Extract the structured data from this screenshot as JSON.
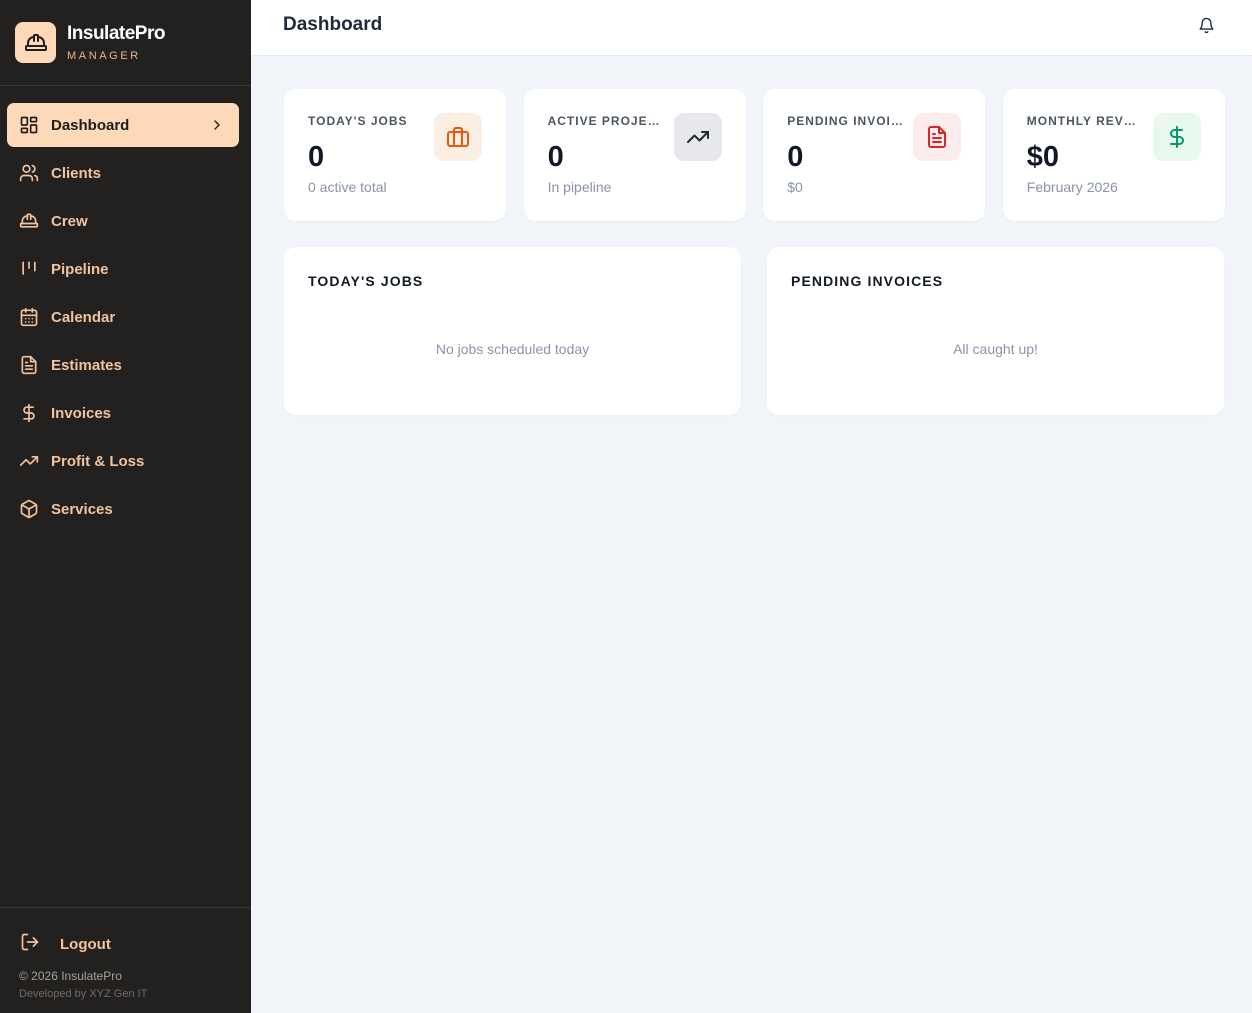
{
  "brand": {
    "name": "InsulatePro",
    "subtitle": "MANAGER"
  },
  "nav": {
    "items": [
      {
        "label": "Dashboard",
        "icon": "dashboard-icon",
        "active": true
      },
      {
        "label": "Clients",
        "icon": "users-icon"
      },
      {
        "label": "Crew",
        "icon": "hard-hat-icon"
      },
      {
        "label": "Pipeline",
        "icon": "kanban-icon"
      },
      {
        "label": "Calendar",
        "icon": "calendar-icon"
      },
      {
        "label": "Estimates",
        "icon": "file-text-icon"
      },
      {
        "label": "Invoices",
        "icon": "dollar-icon"
      },
      {
        "label": "Profit & Loss",
        "icon": "trending-up-icon"
      },
      {
        "label": "Services",
        "icon": "package-icon"
      }
    ]
  },
  "footer": {
    "logout_label": "Logout",
    "copyright": "© 2026 InsulatePro",
    "developed_by": "Developed by XYZ Gen IT"
  },
  "header": {
    "title": "Dashboard"
  },
  "stats": [
    {
      "label": "TODAY'S JOBS",
      "value": "0",
      "sub": "0 active total",
      "icon": "briefcase-icon",
      "icon_bg": "#fdeee4",
      "icon_color": "#ea580c"
    },
    {
      "label": "ACTIVE PROJECTS",
      "value": "0",
      "sub": "In pipeline",
      "icon": "trending-up-icon",
      "icon_bg": "#e6e8eb",
      "icon_color": "#1f2937"
    },
    {
      "label": "PENDING INVOICES",
      "value": "0",
      "sub": "$0",
      "icon": "file-text-icon",
      "icon_bg": "#fdecec",
      "icon_color": "#dc2626"
    },
    {
      "label": "MONTHLY REVENUE",
      "value": "$0",
      "sub": "February 2026",
      "icon": "dollar-icon",
      "icon_bg": "#e8f8ef",
      "icon_color": "#059669"
    }
  ],
  "panels": {
    "todays_jobs": {
      "title": "TODAY'S JOBS",
      "empty": "No jobs scheduled today"
    },
    "pending_invoices": {
      "title": "PENDING INVOICES",
      "empty": "All caught up!"
    }
  },
  "colors": {
    "sidebar_bg": "#232120",
    "accent": "#fdd9b9",
    "nav_text": "#f2c39c",
    "page_bg": "#f1f4f9"
  }
}
